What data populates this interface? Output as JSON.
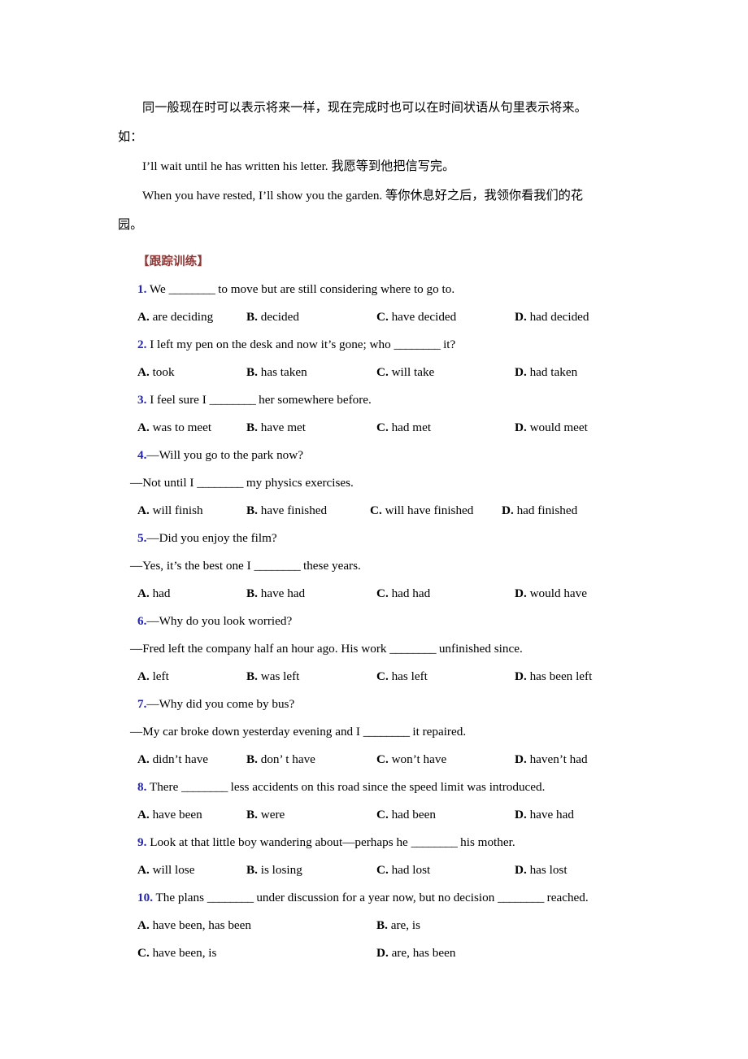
{
  "document": {
    "intro": {
      "line1": "同一般现在时可以表示将来一样，现在完成时也可以在时间状语从句里表示将来。",
      "line2": "如：",
      "example1": "I’ll wait until he has written his letter. 我愿等到他把信写完。",
      "example2": "When you have rested, I’ll show you the garden. 等你休息好之后，我领你看我们的花",
      "example2_wrap": "园。"
    },
    "section": {
      "heading": "【跟踪训练】",
      "heading_color": "#943634",
      "number_color": "#2222CC"
    },
    "blank": "________",
    "questions": [
      {
        "num": "1.",
        "stem_before": " We ",
        "stem_after": " to move but are still considering where to go to.",
        "lines": [],
        "layout": "four",
        "options": [
          {
            "label": "A.",
            "text": " are deciding"
          },
          {
            "label": "B.",
            "text": " decided"
          },
          {
            "label": "C.",
            "text": " have decided"
          },
          {
            "label": "D.",
            "text": " had decided"
          }
        ]
      },
      {
        "num": "2.",
        "stem_before": " I left my pen on the desk and now it’s gone; who ",
        "stem_after": " it?",
        "lines": [],
        "layout": "four",
        "options": [
          {
            "label": "A.",
            "text": " took"
          },
          {
            "label": "B.",
            "text": " has taken"
          },
          {
            "label": "C.",
            "text": " will take"
          },
          {
            "label": "D.",
            "text": " had taken"
          }
        ]
      },
      {
        "num": "3.",
        "stem_before": " I feel sure I ",
        "stem_after": " her somewhere before.",
        "lines": [],
        "layout": "four",
        "options": [
          {
            "label": "A.",
            "text": " was to meet"
          },
          {
            "label": "B.",
            "text": " have met"
          },
          {
            "label": "C.",
            "text": " had met"
          },
          {
            "label": "D.",
            "text": " would meet"
          }
        ]
      },
      {
        "num": "4.",
        "stem_before": "—Will you go to the park now?",
        "stem_after": "",
        "lines": [
          {
            "before": "—Not until I ",
            "after": " my physics exercises."
          }
        ],
        "layout": "tight",
        "options": [
          {
            "label": "A.",
            "text": " will finish"
          },
          {
            "label": "B.",
            "text": " have finished"
          },
          {
            "label": "C.",
            "text": " will have finished"
          },
          {
            "label": "D.",
            "text": " had finished"
          }
        ]
      },
      {
        "num": "5.",
        "stem_before": "—Did you enjoy the film?",
        "stem_after": "",
        "lines": [
          {
            "before": "—Yes, it’s the best one I ",
            "after": " these years."
          }
        ],
        "layout": "four",
        "options": [
          {
            "label": "A.",
            "text": " had"
          },
          {
            "label": "B.",
            "text": " have had"
          },
          {
            "label": "C.",
            "text": " had had"
          },
          {
            "label": "D.",
            "text": " would have"
          }
        ]
      },
      {
        "num": "6.",
        "stem_before": "—Why do you look worried?",
        "stem_after": "",
        "lines": [
          {
            "before": "—Fred left the company half an hour ago. His work ",
            "after": " unfinished since."
          }
        ],
        "layout": "four",
        "options": [
          {
            "label": "A.",
            "text": " left"
          },
          {
            "label": "B.",
            "text": " was left"
          },
          {
            "label": "C.",
            "text": " has left"
          },
          {
            "label": "D.",
            "text": " has been left"
          }
        ]
      },
      {
        "num": "7.",
        "stem_before": "—Why did you come by bus?",
        "stem_after": "",
        "lines": [
          {
            "before": "—My car broke down yesterday evening and I ",
            "after": " it repaired."
          }
        ],
        "layout": "four",
        "options": [
          {
            "label": "A.",
            "text": " didn’t have"
          },
          {
            "label": "B.",
            "text": " don’ t have"
          },
          {
            "label": "C.",
            "text": " won’t have"
          },
          {
            "label": "D.",
            "text": " haven’t had"
          }
        ]
      },
      {
        "num": "8.",
        "stem_before": " There ",
        "stem_after": " less accidents on this road since the speed limit was introduced.",
        "lines": [],
        "layout": "four",
        "options": [
          {
            "label": "A.",
            "text": " have been"
          },
          {
            "label": "B.",
            "text": " were"
          },
          {
            "label": "C.",
            "text": " had been"
          },
          {
            "label": "D.",
            "text": " have had"
          }
        ]
      },
      {
        "num": "9.",
        "stem_before": " Look at that little boy wandering about—perhaps he ",
        "stem_after": " his mother.",
        "lines": [],
        "layout": "four",
        "options": [
          {
            "label": "A.",
            "text": " will lose"
          },
          {
            "label": "B.",
            "text": " is losing"
          },
          {
            "label": "C.",
            "text": " had lost"
          },
          {
            "label": "D.",
            "text": " has lost"
          }
        ]
      },
      {
        "num": "10.",
        "stem_before": " The plans ",
        "stem_mid": " under discussion for a year now, but no decision ",
        "stem_after": " reached.",
        "lines": [],
        "layout": "wide",
        "options": [
          {
            "label": "A.",
            "text": " have been, has been"
          },
          {
            "label": "B.",
            "text": " are, is"
          },
          {
            "label": "C.",
            "text": " have been, is"
          },
          {
            "label": "D.",
            "text": " are, has been"
          }
        ]
      }
    ]
  }
}
